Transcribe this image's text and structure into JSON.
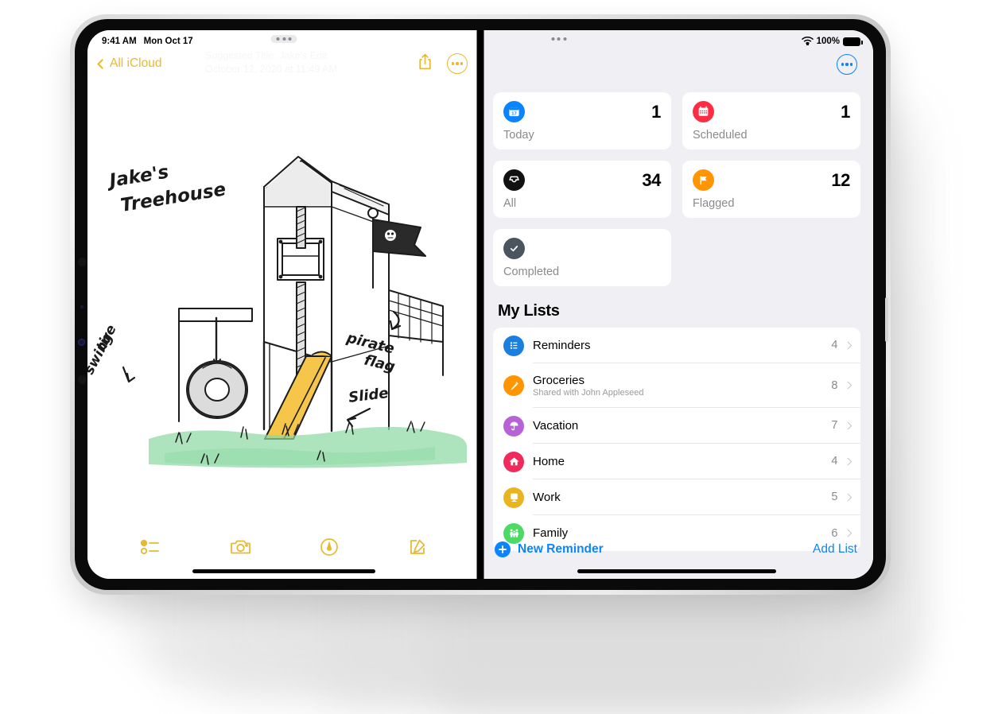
{
  "notes": {
    "statusbar": {
      "time": "9:41 AM",
      "date": "Mon Oct 17"
    },
    "back_label": "All iCloud",
    "ghost_line1": "Suggested Title: Jake's  Edit",
    "ghost_line2": "October 12, 2020 at 11:49 AM",
    "share_icon": "share-icon",
    "more_icon": "more-ellipsis-icon",
    "drawing": {
      "title_annotation": "Jake's Treehouse",
      "annotations": [
        {
          "label": "tire swing"
        },
        {
          "label": "pirate flag"
        },
        {
          "label": "Slide"
        }
      ],
      "colors": {
        "slide": "#F5C64A",
        "grass": "#8ED9A3",
        "ink": "#1a1a1a"
      }
    },
    "toolbar": [
      {
        "name": "checklist-icon",
        "label": "Checklist"
      },
      {
        "name": "camera-icon",
        "label": "Camera"
      },
      {
        "name": "markup-pen-icon",
        "label": "Markup"
      },
      {
        "name": "compose-icon",
        "label": "Compose"
      }
    ],
    "accent": "#E8B931"
  },
  "reminders": {
    "statusbar": {
      "wifi": "wifi-icon",
      "battery_pct": "100%"
    },
    "more_icon": "more-ellipsis-icon",
    "smart_lists": [
      {
        "label": "Today",
        "count": "1",
        "icon": "calendar-17-icon",
        "color": "#0A84FF"
      },
      {
        "label": "Scheduled",
        "count": "1",
        "icon": "calendar-grid-icon",
        "color": "#FF2D44"
      },
      {
        "label": "All",
        "count": "34",
        "icon": "inbox-tray-icon",
        "color": "#111111"
      },
      {
        "label": "Flagged",
        "count": "12",
        "icon": "flag-icon",
        "color": "#FF9500"
      },
      {
        "label": "Completed",
        "count": "",
        "icon": "checkmark-icon",
        "color": "#4A5560"
      }
    ],
    "section_title": "My Lists",
    "lists": [
      {
        "name": "Reminders",
        "sub": "",
        "count": "4",
        "icon": "bulleted-list-icon",
        "color": "#1B7FE0"
      },
      {
        "name": "Groceries",
        "sub": "Shared with John Appleseed",
        "count": "8",
        "icon": "carrot-icon",
        "color": "#FF9500"
      },
      {
        "name": "Vacation",
        "sub": "",
        "count": "7",
        "icon": "umbrella-icon",
        "color": "#B862D8"
      },
      {
        "name": "Home",
        "sub": "",
        "count": "4",
        "icon": "house-icon",
        "color": "#F2295B"
      },
      {
        "name": "Work",
        "sub": "",
        "count": "5",
        "icon": "monitor-icon",
        "color": "#E8B420"
      },
      {
        "name": "Family",
        "sub": "",
        "count": "6",
        "icon": "people-icon",
        "color": "#4CD964"
      }
    ],
    "new_reminder_label": "New Reminder",
    "add_list_label": "Add List",
    "accent": "#0A84FF",
    "background": "#EFEFF4"
  }
}
